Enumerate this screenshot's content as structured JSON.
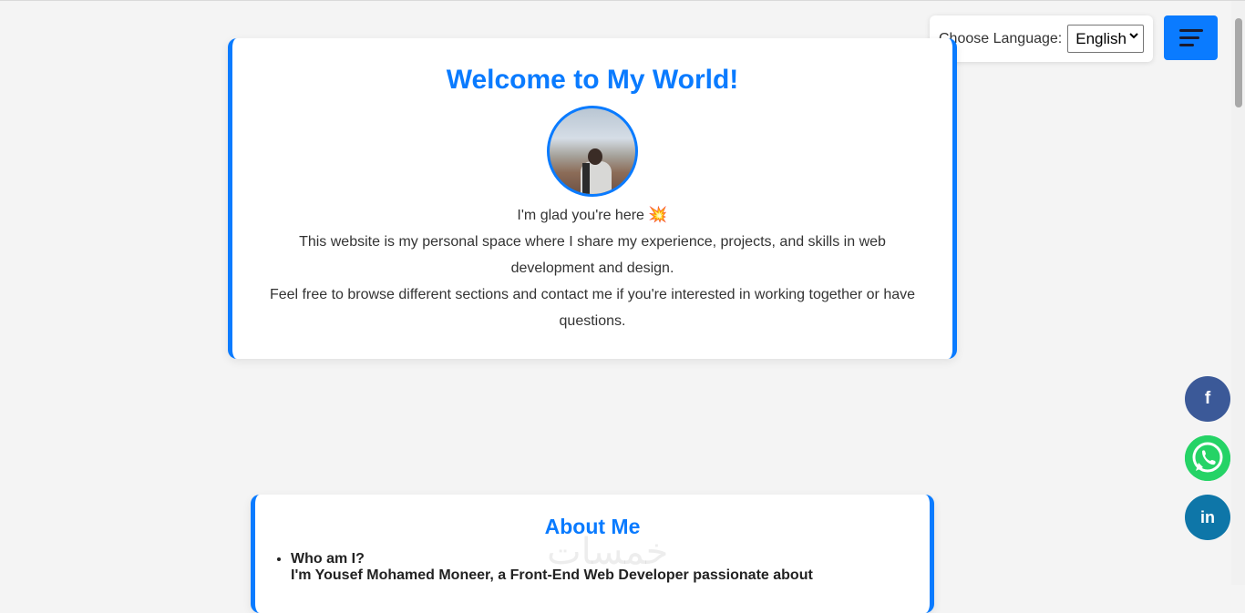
{
  "language": {
    "label": "Choose Language:",
    "selected": "English"
  },
  "welcome": {
    "title": "Welcome to My World!",
    "line1": "I'm glad you're here",
    "sparkle_icon": "💥",
    "line2": "This website is my personal space where I share my experience, projects, and skills in web development and design.",
    "line3": "Feel free to browse different sections and contact me if you're interested in working together or have questions."
  },
  "about": {
    "title": "About Me",
    "item_heading": "Who am I?",
    "item_text": "I'm Yousef Mohamed Moneer, a Front-End Web Developer passionate about"
  },
  "watermark": "خمسات",
  "social": {
    "facebook": "f",
    "linkedin": "in"
  },
  "colors": {
    "accent": "#0a7bff",
    "facebook": "#3b5998",
    "whatsapp": "#25d366",
    "linkedin": "#0e76a8"
  }
}
